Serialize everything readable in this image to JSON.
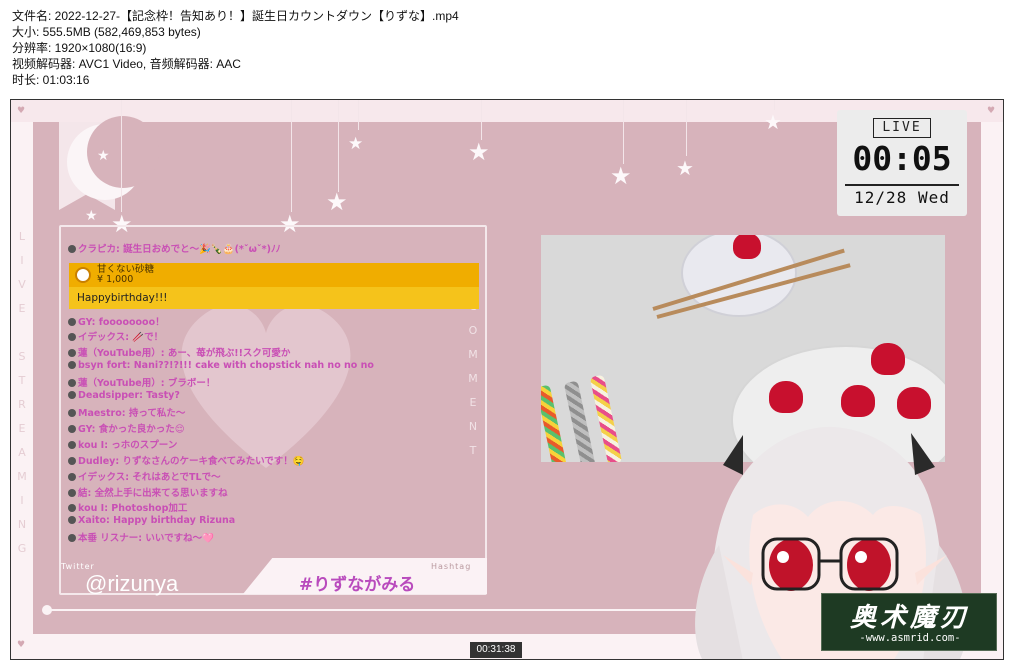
{
  "file_info": {
    "filename": "文件名: 2022-12-27-【記念枠！告知あり！】誕生日カウントダウン【りずな】.mp4",
    "size": "大小: 555.5MB (582,469,853 bytes)",
    "resolution": "分辨率: 1920×1080(16:9)",
    "codec": "视频解码器: AVC1 Video, 音频解码器: AAC",
    "duration": "时长: 01:03:16"
  },
  "stream": {
    "side_text": "LIVE STREAMING",
    "comment_text": "COMMENT",
    "clock": {
      "badge": "LIVE",
      "time": "00:05",
      "date": "12/28 Wed"
    },
    "superchat": {
      "name": "甘くない砂糖",
      "amount": "¥ 1,000",
      "message": "Happybirthday!!!"
    },
    "chat": [
      {
        "text": "クラピカ: 誕生日おめでと〜🎉🍾🎂(*ˇωˇ*)ﾉﾉ",
        "color": "#c94fb5"
      },
      {
        "text": "GY: foooooooo！",
        "color": "#c94fb5"
      },
      {
        "text": "イデックス: 🥢で！",
        "color": "#c94fb5"
      },
      {
        "text": "蓮（YouTube用）: あー、苺が飛ぶ!!スク可愛か",
        "color": "#c94fb5"
      },
      {
        "text": "bsyn fort: Nani??!?!!! cake with chopstick nah no no no",
        "color": "#c94fb5"
      },
      {
        "text": "蓮（YouTube用）: ブラボー！",
        "color": "#c94fb5"
      },
      {
        "text": "Deadsipper: Tasty?",
        "color": "#c94fb5"
      },
      {
        "text": "Maestro: 持って私た〜",
        "color": "#c94fb5"
      },
      {
        "text": "GY: 食かった良かった😌",
        "color": "#c94fb5"
      },
      {
        "text": "kou I: っホのスプーン",
        "color": "#c94fb5"
      },
      {
        "text": "Dudley: りずなさんのケーキ食べてみたいです！🤤",
        "color": "#c94fb5"
      },
      {
        "text": "イデックス: それはあとでTLで〜",
        "color": "#c94fb5"
      },
      {
        "text": "結: 全然上手に出来てる思いますね",
        "color": "#c94fb5"
      },
      {
        "text": "kou I: Photoshop加工",
        "color": "#c94fb5"
      },
      {
        "text": "Xaito: Happy birthday Rizuna",
        "color": "#c94fb5"
      },
      {
        "text": "本垂 リスナー: いいですね〜🩷",
        "color": "#c94fb5"
      }
    ],
    "twitter_label": "Twitter",
    "twitter_handle": "@rizunya",
    "hashtag_label": "Hashtag",
    "hashtag": "#りずながみる"
  },
  "watermark": {
    "title": "奥术魔刃",
    "url": "-www.asmrid.com-"
  },
  "player": {
    "timestamp": "00:31:38"
  },
  "colors": {
    "frame_pink": "#d7b3bb",
    "chat_text": "#c94fb5",
    "superchat_head": "#f0ad00",
    "superchat_body": "#f5c31b",
    "watermark_bg": "#1e3a23"
  }
}
